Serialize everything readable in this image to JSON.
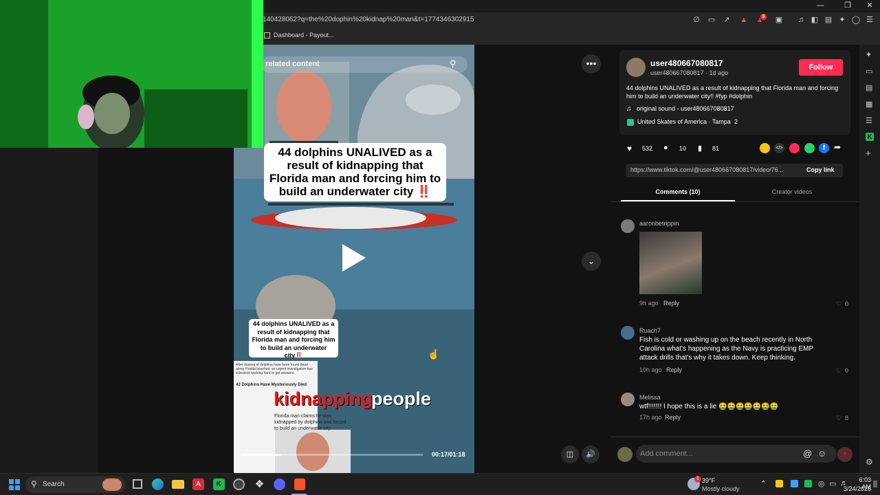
{
  "browser": {
    "url": "140428062?q=the%20dophin%20kidnap%20man&t=1774346302915",
    "bookmark_label": "Dashboard - Payout...",
    "badge_count": "9"
  },
  "video": {
    "search_placeholder": "related content",
    "headline": "44 dolphins UNALIVED as a result of kidnapping that Florida man and forcing him to build an underwater city ‼️",
    "inset_caption": "44 dolphins UNALIVED as a result of kidnapping that Florida man and forcing him to build an underwater city‼️",
    "article_snippet": "After dozens of dolphins have been found dead along Florida beaches, an urgent investigation has scientists working hard to get answers.",
    "article_headline": "42 Dolphins Have Mysteriously Died",
    "claim_text": "Florida man claims he was kidnapped by dolphins and forced to build an underwater city.",
    "subtitle_red": "kidnapping",
    "subtitle_white": "people",
    "time": "00:17/01:18",
    "progress": 0.22
  },
  "post": {
    "username": "user480667080817",
    "handle_line": "user480667080817 · 1d ago",
    "follow_label": "Follow",
    "description": "44 dolphins UNALIVED as a result of kidnapping that Florida man and forcing him to build an underwater city!! #fyp #dolphin",
    "sound": "original sound - user480667080817",
    "location": "United Skates of America · Tampa",
    "location_count": "2",
    "likes": "532",
    "comments": "10",
    "saves": "81",
    "link": "https://www.tiktok.com/@user480667080817/video/76...",
    "copy_link": "Copy link",
    "tab_comments": "Comments (10)",
    "tab_creator": "Creator videos"
  },
  "comments": [
    {
      "name": "aaronbetrippin",
      "text": "",
      "time": "9h ago",
      "reply": "Reply",
      "likes": "0"
    },
    {
      "name": "Ruach7",
      "text": "Fish is cold or washing up on the beach recently in North Carolina what's happening as the Navy is practicing EMP attack drills that's why it takes down. Keep thinking.",
      "time": "10h ago",
      "reply": "Reply",
      "likes": "0"
    },
    {
      "name": "Melissa",
      "text": "wtf!!!!!!! I hope this is a lie 🤮🤮🤮🤮🤮🤮🤮",
      "time": "17h ago",
      "reply": "Reply",
      "likes": "8"
    }
  ],
  "comment_input": {
    "placeholder": "Add comment..."
  },
  "taskbar": {
    "search_label": "Search",
    "weather_temp": "39°F",
    "weather_desc": "Mostly cloudy",
    "weather_badge": "1",
    "time": "6:03 AM",
    "date": "3/24/2026"
  },
  "colors": {
    "accent": "#fe2c55",
    "video_bg": "#2f4e5e",
    "panel_bg": "#121212"
  }
}
